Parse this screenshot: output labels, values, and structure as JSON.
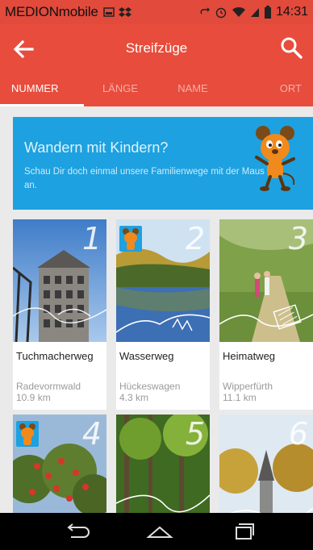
{
  "status": {
    "carrier": "MEDIONmobile",
    "time": "14:31"
  },
  "toolbar": {
    "title": "Streifzüge"
  },
  "tabs": [
    {
      "label": "NUMMER",
      "active": true
    },
    {
      "label": "LÄNGE",
      "active": false
    },
    {
      "label": "NAME",
      "active": false
    },
    {
      "label": "ORT",
      "active": false
    }
  ],
  "banner": {
    "title": "Wandern mit Kindern?",
    "text": "Schau Dir doch einmal unsere Familienwege mit der Maus an."
  },
  "routes": [
    {
      "number": "1",
      "name": "Tuchmacherweg",
      "place": "Radevormwald",
      "length": "10.9 km",
      "maus": false
    },
    {
      "number": "2",
      "name": "Wasserweg",
      "place": "Hückeswagen",
      "length": "4.3 km",
      "maus": true
    },
    {
      "number": "3",
      "name": "Heimatweg",
      "place": "Wipperfürth",
      "length": "11.1 km",
      "maus": false
    },
    {
      "number": "4",
      "maus": true
    },
    {
      "number": "5",
      "maus": false
    },
    {
      "number": "6",
      "maus": false
    }
  ],
  "colors": {
    "accent": "#e74c3c",
    "banner": "#1da1e0"
  }
}
